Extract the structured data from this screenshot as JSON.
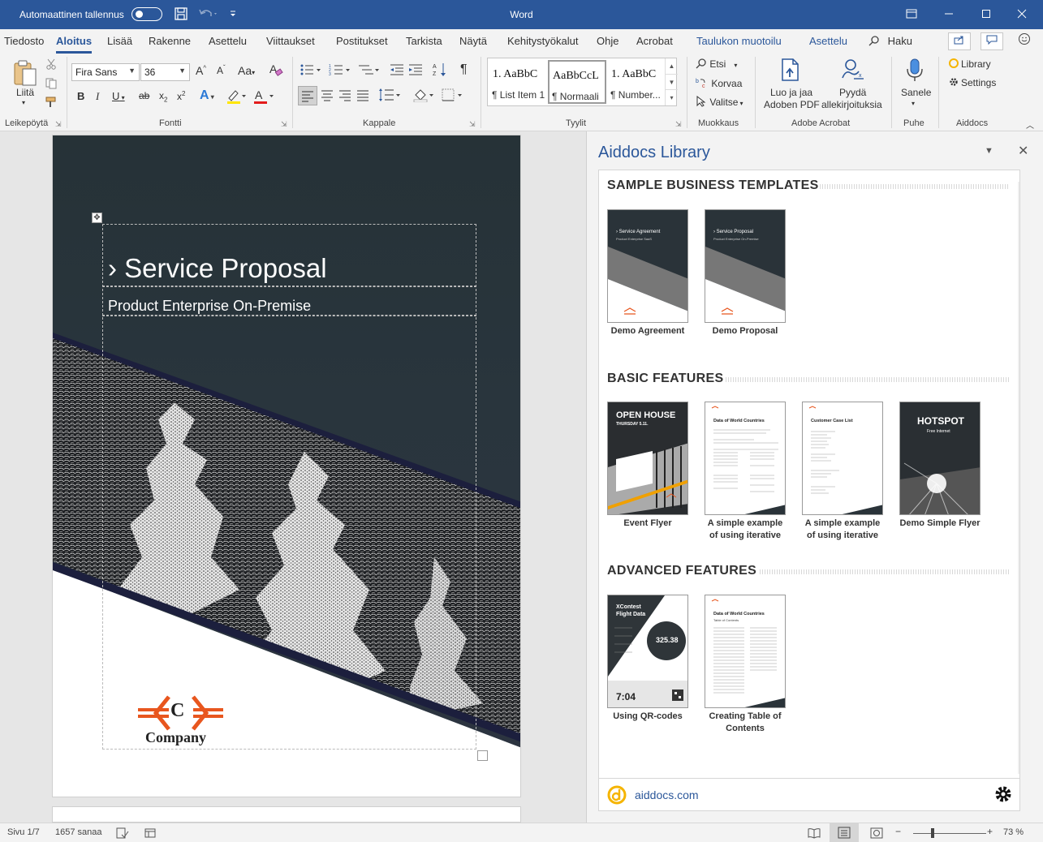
{
  "titlebar": {
    "autosave_label": "Automaattinen tallennus",
    "app_title": "Word"
  },
  "menu": {
    "tabs": [
      {
        "label": "Tiedosto"
      },
      {
        "label": "Aloitus"
      },
      {
        "label": "Lisää"
      },
      {
        "label": "Rakenne"
      },
      {
        "label": "Asettelu"
      },
      {
        "label": "Viittaukset"
      },
      {
        "label": "Postitukset"
      },
      {
        "label": "Tarkista"
      },
      {
        "label": "Näytä"
      },
      {
        "label": "Kehitystyökalut"
      },
      {
        "label": "Ohje"
      },
      {
        "label": "Acrobat"
      },
      {
        "label": "Taulukon muotoilu"
      },
      {
        "label": "Asettelu"
      }
    ],
    "search_label": "Haku"
  },
  "ribbon": {
    "clipboard": {
      "paste_label": "Liitä",
      "group_label": "Leikepöytä"
    },
    "font": {
      "font_name": "Fira Sans",
      "font_size": "36",
      "group_label": "Fontti"
    },
    "paragraph": {
      "group_label": "Kappale"
    },
    "styles": {
      "group_label": "Tyylit",
      "items": [
        {
          "preview": "1.  AaBbC",
          "name": "¶ List Item 1"
        },
        {
          "preview": "AaBbCcL",
          "name": "¶ Normaali"
        },
        {
          "preview": "1.  AaBbC",
          "name": "¶ Number..."
        }
      ]
    },
    "editing": {
      "find": "Etsi",
      "replace": "Korvaa",
      "select": "Valitse",
      "group_label": "Muokkaus"
    },
    "acrobat": {
      "create_pdf_line1": "Luo ja jaa",
      "create_pdf_line2": "Adoben PDF",
      "sign_line1": "Pyydä",
      "sign_line2": "allekirjoituksia",
      "group_label": "Adobe Acrobat"
    },
    "voice": {
      "dictate": "Sanele",
      "group_label": "Puhe"
    },
    "aiddocs": {
      "library": "Library",
      "settings": "Settings",
      "group_label": "Aiddocs"
    }
  },
  "document": {
    "title": "› Service Proposal",
    "subtitle": "Product Enterprise On-Premise",
    "logo_letter": "C",
    "company": "Company"
  },
  "taskpane": {
    "title": "Aiddocs Library",
    "sections": [
      {
        "heading": "SAMPLE BUSINESS TEMPLATES",
        "items": [
          {
            "caption": "Demo Agreement",
            "thumb_title": "› Service Agreement",
            "thumb_sub": "Product Enterprise SaaS",
            "kind": "cover"
          },
          {
            "caption": "Demo Proposal",
            "thumb_title": "› Service Proposal",
            "thumb_sub": "Product Enterprise On-Premise",
            "kind": "cover"
          }
        ]
      },
      {
        "heading": "BASIC FEATURES",
        "items": [
          {
            "caption": "Event Flyer",
            "thumb_title": "OPEN HOUSE",
            "thumb_sub": "THURSDAY 5.11.",
            "kind": "flyer"
          },
          {
            "caption": "A simple example of using iterative parts",
            "thumb_title": "Data of World Countries",
            "thumb_sub": "",
            "kind": "doc"
          },
          {
            "caption": "A simple example of using iterative parts",
            "thumb_title": "Customer Case List",
            "thumb_sub": "",
            "kind": "doc"
          },
          {
            "caption": "Demo Simple Flyer",
            "thumb_title": "HOTSPOT",
            "thumb_sub": "Free Internet",
            "kind": "hotspot"
          }
        ]
      },
      {
        "heading": "ADVANCED FEATURES",
        "items": [
          {
            "caption": "Using QR-codes",
            "thumb_title": "XContest Flight Data",
            "thumb_sub": "325.38",
            "thumb_extra": "7:04",
            "kind": "qr"
          },
          {
            "caption": "Creating Table of Contents",
            "thumb_title": "Data of World Countries",
            "thumb_sub": "Table of Contents",
            "kind": "doc"
          }
        ]
      }
    ],
    "footer_link": "aiddocs.com"
  },
  "status": {
    "page": "Sivu 1/7",
    "words": "1657 sanaa",
    "zoom": "73 %"
  },
  "colors": {
    "brand": "#2b579a",
    "logo_orange": "#e8561e",
    "cover_dark": "#263237",
    "cover_stripe": "#1c1f3d",
    "aiddocs_yellow": "#f5b400"
  }
}
